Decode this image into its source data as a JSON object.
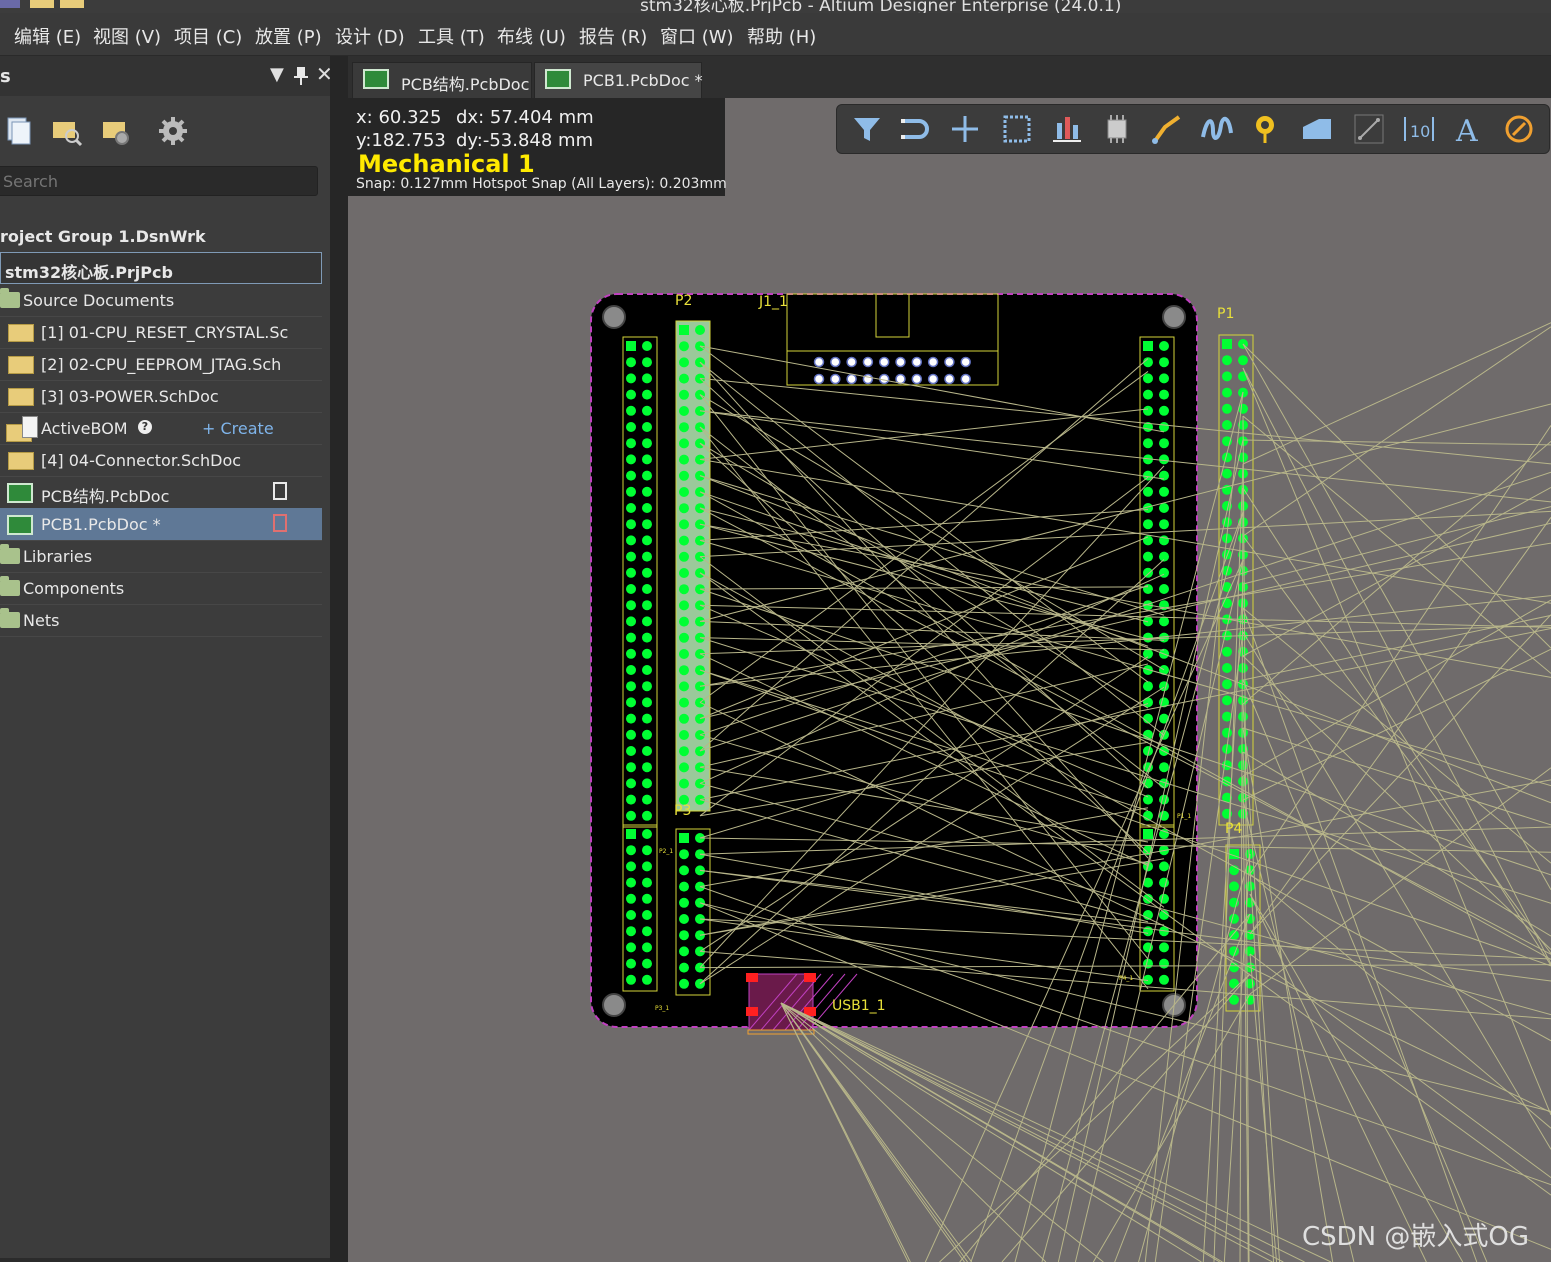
{
  "window": {
    "title": "stm32核心板.PrjPcb - Altium Designer Enterprise (24.0.1)"
  },
  "menu": [
    "编辑 (E)",
    "视图 (V)",
    "项目 (C)",
    "放置 (P)",
    "设计 (D)",
    "工具 (T)",
    "布线 (U)",
    "报告 (R)",
    "窗口 (W)",
    "帮助 (H)"
  ],
  "panel": {
    "title": "s",
    "search_placeholder": "Search",
    "workspace": "roject Group 1.DsnWrk",
    "project": "stm32核心板.PrjPcb",
    "source_documents": "Source Documents",
    "docs": [
      "[1] 01-CPU_RESET_CRYSTAL.Sc",
      "[2] 02-CPU_EEPROM_JTAG.Sch",
      "[3] 03-POWER.SchDoc"
    ],
    "activebom": "ActiveBOM",
    "create": "+ Create",
    "doc4": "[4] 04-Connector.SchDoc",
    "pcb_structure": "PCB结构.PcbDoc",
    "pcb1": "PCB1.PcbDoc *",
    "libraries": "Libraries",
    "components": "Components",
    "nets": "Nets"
  },
  "tabs": [
    "PCB结构.PcbDoc",
    "PCB1.PcbDoc *"
  ],
  "hud": {
    "x": "x: 60.325",
    "dx": "dx: 57.404  mm",
    "y": "y:182.753",
    "dy": "dy:-53.848 mm",
    "layer": "Mechanical 1",
    "snap": "Snap: 0.127mm Hotspot Snap (All Layers): 0.203mm"
  },
  "toolbar_icons": [
    "filter-icon",
    "interactive-route-icon",
    "cross-icon",
    "select-rect-icon",
    "align-icon",
    "component-icon",
    "track-icon",
    "diff-pair-icon",
    "via-icon",
    "polygon-icon",
    "line-icon",
    "dimension-icon",
    "text-icon",
    "arc-icon"
  ],
  "designators": {
    "p2": "P2",
    "j1": "J1_1",
    "p1": "P1",
    "p3": "P3",
    "p4": "P4",
    "usb": "USB1_1",
    "p1_ref": "P1_1",
    "p2_ref": "P2_1",
    "p3_ref": "P3_1",
    "p4_ref": "P4_1"
  },
  "watermark": "CSDN @嵌入式OG",
  "colors": {
    "canvas": "#6f6b6b",
    "board": "#000000",
    "outline": "#c040c0",
    "pad": "#00ff33",
    "silk": "#ffff33",
    "ratsnest": "#b8b68a",
    "layer_text": "#ffea00",
    "selection": "#5f7896"
  }
}
